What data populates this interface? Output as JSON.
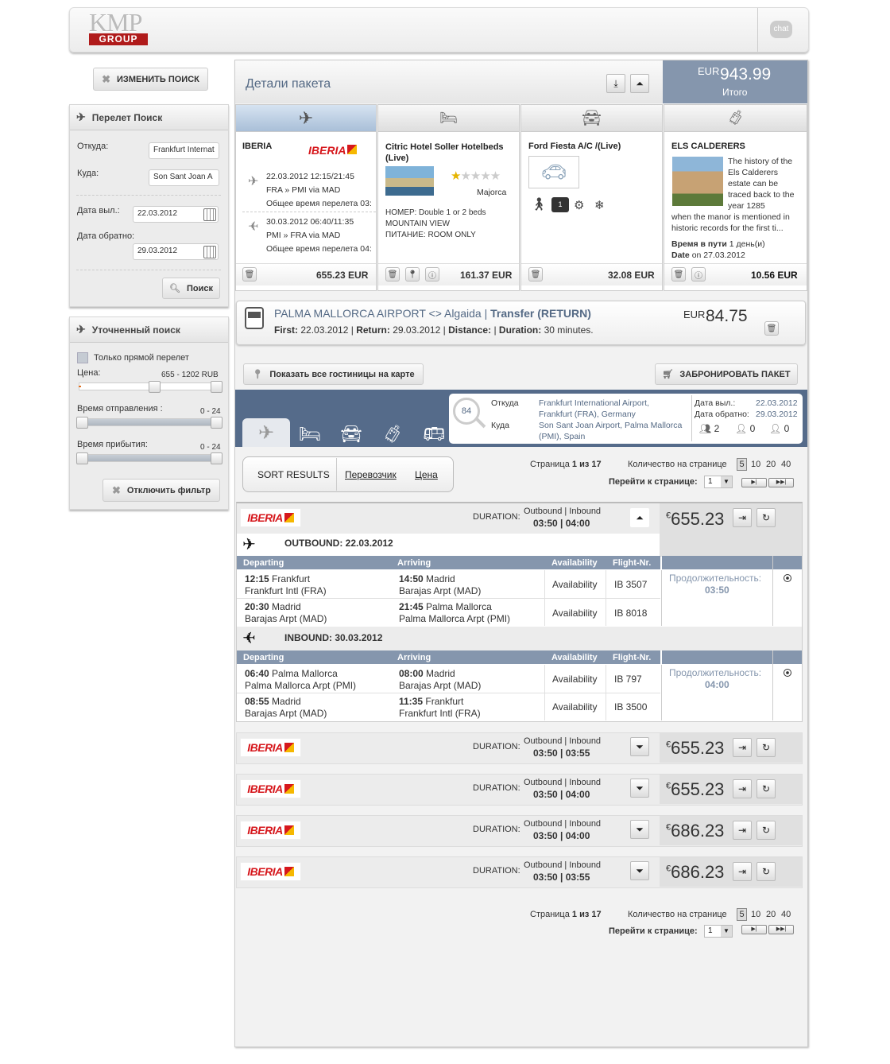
{
  "header": {
    "logo_top": "KMP",
    "logo_bottom": "GROUP",
    "chat_label": "chat"
  },
  "left": {
    "change_search": "ИЗМЕНИТЬ ПОИСК",
    "flight_search": {
      "title": "Перелет Поиск",
      "from_label": "Откуда:",
      "from_value": "Frankfurt Internat",
      "to_label": "Куда:",
      "to_value": "Son Sant Joan A",
      "depart_label": "Дата выл.:",
      "depart_value": "22.03.2012",
      "return_label": "Дата обратно:",
      "return_value": "29.03.2012",
      "search_button": "Поиск"
    },
    "refine": {
      "title": "Уточненный поиск",
      "direct_only": "Только прямой перелет",
      "price_label": "Цена:",
      "price_range": "655 - 1202 RUB",
      "dep_time_label": "Время отправления :",
      "dep_time_range": "0 - 24",
      "arr_time_label": "Время прибытия:",
      "arr_time_range": "0 - 24",
      "disable_filter": "Отключить фильтр"
    }
  },
  "package": {
    "title": "Детали пакета",
    "total_currency": "EUR",
    "total_amount": "943.99",
    "total_label": "Итого",
    "flight": {
      "carrier": "IBERIA",
      "logo": "IBERIA",
      "out_date": "22.03.2012 12:15/21:45",
      "out_route": "FRA » PMI via MAD",
      "out_total": "Общее время перелета 03:",
      "in_date": "30.03.2012 06:40/11:35",
      "in_route": "PMI » FRA via MAD",
      "in_total": "Общее время перелета 04:",
      "price": "655.23 EUR"
    },
    "hotel": {
      "name": "Citric Hotel Soller Hotelbeds (Live)",
      "location": "Majorca",
      "room": "НОМЕР: Double 1 or 2 beds MOUNTAIN VIEW",
      "meal": "ПИТАНИЕ: ROOM ONLY",
      "stars": 1,
      "price": "161.37 EUR"
    },
    "car": {
      "name": "Ford Fiesta A/C /(Live)",
      "bag_count": "1",
      "price": "32.08 EUR"
    },
    "activity": {
      "name": "ELS CALDERERS",
      "desc_short": "The history of the Els Calderers estate can be traced back to the year 1285",
      "desc_long": "when the manor is mentioned in historic records for the first ti...",
      "travel_label": "Время в пути",
      "travel_value": "1 день(и)",
      "date_label": "Date",
      "date_value": "on 27.03.2012",
      "price": "10.56 EUR"
    },
    "transfer": {
      "title": "PALMA MALLORCA AIRPORT <> Algaida",
      "type": "Transfer (RETURN)",
      "first_label": "First:",
      "first_value": "22.03.2012",
      "return_label": "Return:",
      "return_value": "29.03.2012",
      "distance_label": "Distance:",
      "distance_value": "",
      "duration_label": "Duration:",
      "duration_value": "30 minutes.",
      "currency": "EUR",
      "amount": "84.75"
    },
    "map_button": "Показать все гостиницы на карте",
    "book_button": "ЗАБРОНИРОВАТЬ ПАКЕТ"
  },
  "search_summary": {
    "count": "84",
    "from_label": "Откуда",
    "from_value_1": "Frankfurt International Airport,",
    "from_value_2": "Frankfurt (FRA), Germany",
    "to_label": "Куда",
    "to_value_1": "Son Sant Joan Airport, Palma Mallorca",
    "to_value_2": "(PMI), Spain",
    "depart_label": "Дата выл.:",
    "depart_value": "22.03.2012",
    "return_label": "Дата обратно:",
    "return_value": "29.03.2012",
    "adults": "2",
    "children": "0",
    "infants": "0"
  },
  "sort": {
    "label": "SORT RESULTS",
    "carrier": "Перевозчик",
    "price": "Цена"
  },
  "pagination": {
    "page_label": "Страница",
    "page_current": "1",
    "page_of": "из",
    "page_total": "17",
    "per_page_label": "Количество на странице",
    "per_page_options": [
      "5",
      "10",
      "20",
      "40"
    ],
    "goto_label": "Перейти к странице:",
    "goto_value": "1"
  },
  "results": {
    "duration_label": "DURATION:",
    "ob_ib_label": "Outbound | Inbound",
    "currency_symbol": "€",
    "expanded": {
      "duration": "03:50 | 04:00",
      "price": "655.23",
      "outbound_title": "OUTBOUND: 22.03.2012",
      "inbound_title": "INBOUND: 30.03.2012",
      "headers": [
        "Departing",
        "Arriving",
        "Availability",
        "Flight-Nr."
      ],
      "outbound_rows": [
        {
          "dep_time": "12:15",
          "dep_city": "Frankfurt",
          "dep_airport": "Frankfurt Intl (FRA)",
          "arr_time": "14:50",
          "arr_city": "Madrid",
          "arr_airport": "Barajas Arpt (MAD)",
          "avail": "Availability",
          "flight": "IB 3507"
        },
        {
          "dep_time": "20:30",
          "dep_city": "Madrid",
          "dep_airport": "Barajas Arpt (MAD)",
          "arr_time": "21:45",
          "arr_city": "Palma Mallorca",
          "arr_airport": "Palma Mallorca Arpt (PMI)",
          "avail": "Availability",
          "flight": "IB 8018"
        }
      ],
      "inbound_rows": [
        {
          "dep_time": "06:40",
          "dep_city": "Palma Mallorca",
          "dep_airport": "Palma Mallorca Arpt (PMI)",
          "arr_time": "08:00",
          "arr_city": "Madrid",
          "arr_airport": "Barajas Arpt (MAD)",
          "avail": "Availability",
          "flight": "IB 797"
        },
        {
          "dep_time": "08:55",
          "dep_city": "Madrid",
          "dep_airport": "Barajas Arpt (MAD)",
          "arr_time": "11:35",
          "arr_city": "Frankfurt",
          "arr_airport": "Frankfurt Intl (FRA)",
          "avail": "Availability",
          "flight": "IB 3500"
        }
      ],
      "duration_word": "Продолжительность:",
      "out_duration": "03:50",
      "in_duration": "04:00"
    },
    "collapsed": [
      {
        "duration": "03:50 | 03:55",
        "price": "655.23"
      },
      {
        "duration": "03:50 | 04:00",
        "price": "655.23"
      },
      {
        "duration": "03:50 | 04:00",
        "price": "686.23"
      },
      {
        "duration": "03:50 | 03:55",
        "price": "686.23"
      }
    ]
  }
}
